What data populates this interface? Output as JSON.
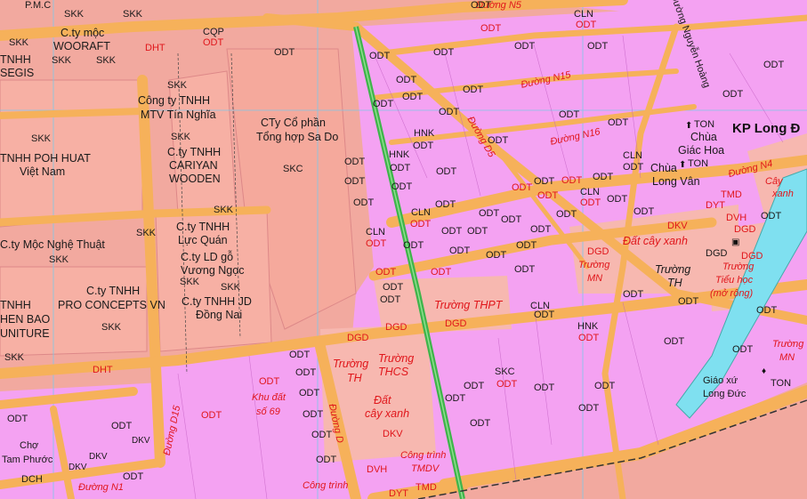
{
  "colors": {
    "industrial": "#f2a99f",
    "residential": "#f4a2f2",
    "road": "#f6b15a",
    "road_edge": "#c8884a",
    "water": "#7fe0f0",
    "green_road": "#3fb44b",
    "public": "#f7b8b0",
    "label_red": "#e0161b"
  },
  "labels": {
    "pmc": "P.M.C",
    "skk1": "SKK",
    "skk2": "SKK",
    "skk3": "SKK",
    "skk4": "SKK",
    "skk5": "SKK",
    "skk6": "SKK",
    "skk7": "SKK",
    "skk8": "SKK",
    "skk9": "SKK",
    "skk10": "SKK",
    "skk11": "SKK",
    "skk12": "SKK",
    "skk13": "SKK",
    "skk14": "SKK",
    "skk15": "SKK",
    "cty_moc": "C.ty mộc",
    "wooraft": "WOORAFT",
    "tnhh1": "TNHH",
    "segis": "SEGIS",
    "dht1": "DHT",
    "dht2": "DHT",
    "cqp": "CQP",
    "odt_top": "ODT",
    "cty_tin_nghia": "Công ty TNHH",
    "mtv_tin_nghia": "MTV Tín Nghĩa",
    "cty_sado1": "CTy Cổ phần",
    "cty_sado2": "Tổng hợp Sa Do",
    "skc": "SKC",
    "tnhh_poh": "TNHH POH HUAT",
    "viet_nam": "Việt Nam",
    "cty_cariyan1": "C.ty TNHH",
    "cty_cariyan2": "CARIYAN",
    "cty_cariyan3": "WOODEN",
    "cty_luc_quan1": "C.ty TNHH",
    "cty_luc_quan2": "Lực Quán",
    "cty_moc_nghe_thuat": "C.ty Mộc Nghệ Thuật",
    "cty_vuong1": "C.ty LD gỗ",
    "cty_vuong2": "Vương Ngọc",
    "cty_pro1": "C.ty TNHH",
    "cty_pro2": "PRO CONCEPTS VN",
    "cty_dong_nai1": "C.ty TNHH JD",
    "cty_dong_nai2": "Đồng Nai",
    "tnhh2": "TNHH",
    "chen_bao": "HEN BAO",
    "furniture": "UNITURE",
    "khu_dat1": "Khu đất",
    "khu_dat2": "số 69",
    "cho1": "Chợ",
    "cho2": "Tam Phước",
    "dch": "DCH",
    "dkv1": "DKV",
    "dkv2": "DKV",
    "dkv3": "DKV",
    "dkv4": "DKV",
    "dkv5": "DKV",
    "duong_n5": "Đường N5",
    "duong_n15": "Đường N15",
    "duong_n16": "Đường N16",
    "duong_n4": "Đường N4",
    "duong_nguyen_hoang": "Đường Nguyễn Hoàng",
    "duong_d5": "Đường D5",
    "duong_d15": "Đường D15",
    "duong_d": "Đường D",
    "duong_n1": "Đường N1",
    "kp_long_duc": "KP Long Đ",
    "chua_giac_hoa1": "Chùa",
    "chua_giac_hoa2": "Giác Hoa",
    "chua_long_van1": "Chùa",
    "chua_long_van2": "Long Vân",
    "ton1": "TON",
    "ton2": "TON",
    "ton3": "TON",
    "cln1": "CLN",
    "cln2": "CLN",
    "cln3": "CLN",
    "cln4": "CLN",
    "cln5": "CLN",
    "cln6": "CLN",
    "hnk1": "HNK",
    "hnk2": "HNK",
    "hnk3": "HNK",
    "tmd1": "TMD",
    "tmd2": "TMD",
    "dvh1": "DVH",
    "dvh2": "DVH",
    "dgd1": "DGD",
    "dgd2": "DGD",
    "dgd3": "DGD",
    "dgd4": "DGD",
    "dgd5": "DGD",
    "dgd6": "DGD",
    "dat_cay_xanh1": "Đất cây xanh",
    "dat_cay_xanh2a": "Đất",
    "dat_cay_xanh2b": "cây xanh",
    "cay_xanh1": "Cây",
    "cay_xanh2": "xanh",
    "truong_mn1": "Trường",
    "truong_mn2": "MN",
    "truong_th1": "Trường",
    "truong_th2": "TH",
    "truong_tieu_hoc1": "Trường",
    "truong_tieu_hoc2": "Tiểu học",
    "truong_tieu_hoc3": "(mở rộng)",
    "truong_thpt": "Trường THPT",
    "truong_th_b1": "Trường",
    "truong_th_b2": "TH",
    "truong_thcs1": "Trường",
    "truong_thcs2": "THCS",
    "truong_mn_b1": "Trường",
    "truong_mn_b2": "MN",
    "giao_xu1": "Giáo xứ",
    "giao_xu2": "Long Đức",
    "cong_trinh1": "Công trình",
    "cong_trinh2": "TMDV",
    "cong_trinh_b": "Công trình",
    "cong_trinh_c": "văn hóa",
    "dyt1": "DYT",
    "dyt2": "DYT",
    "skc2": "SKC",
    "odt": "ODT",
    "dkv_big": "DKV"
  },
  "odt_labels": [
    "ODT",
    "ODT",
    "ODT",
    "ODT",
    "ODT",
    "ODT",
    "ODT",
    "ODT",
    "ODT",
    "ODT",
    "ODT",
    "ODT",
    "ODT",
    "ODT",
    "ODT",
    "ODT",
    "ODT",
    "ODT",
    "ODT",
    "ODT",
    "ODT",
    "ODT",
    "ODT",
    "ODT",
    "ODT",
    "ODT",
    "ODT",
    "ODT",
    "ODT",
    "ODT",
    "ODT",
    "ODT",
    "ODT",
    "ODT",
    "ODT",
    "ODT",
    "ODT",
    "ODT",
    "ODT",
    "ODT",
    "ODT",
    "ODT",
    "ODT",
    "ODT",
    "ODT",
    "ODT",
    "ODT",
    "ODT",
    "ODT",
    "ODT",
    "ODT",
    "ODT",
    "ODT",
    "ODT",
    "ODT",
    "ODT",
    "ODT",
    "ODT",
    "ODT",
    "ODT",
    "ODT",
    "ODT",
    "ODT",
    "ODT",
    "ODT",
    "ODT",
    "ODT",
    "ODT",
    "ODT",
    "ODT",
    "ODT",
    "ODT",
    "ODT",
    "ODT",
    "ODT",
    "ODT",
    "ODT",
    "ODT"
  ],
  "icons": {
    "temple": "temple-icon",
    "school": "school-icon",
    "church": "church-icon"
  }
}
